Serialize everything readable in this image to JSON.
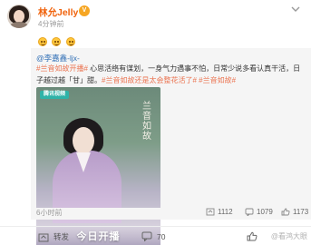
{
  "post": {
    "author": "林允Jelly",
    "time": "4分钟前",
    "vip_badge": "V"
  },
  "repost": {
    "author": "@李嘉鑫-ljx-",
    "text_tag1": "#兰音如故开播#",
    "text_body": " 心思活络有谋划，一身气力遇事不怕，日常少说多看认真干活，日子越过越「甘」甜。",
    "text_tag2": "#兰音如故还是太会整花活了#",
    "text_tag3": " #兰音如故#",
    "poster": {
      "platform_label": "腾讯视频",
      "title_art": "兰音如故",
      "banner": "今日开播"
    },
    "footer": {
      "time": "6小时前",
      "reposts": "1112",
      "comments": "1079",
      "likes": "1173"
    }
  },
  "actions": {
    "repost_label": "转发",
    "comment_count": "70",
    "watermark": "@看鸿大眼"
  },
  "colors": {
    "author_orange": "#f0630d",
    "link_blue": "#2f6eb5",
    "tag_orange": "#eb7350",
    "repost_bg": "#f5f5f5"
  }
}
